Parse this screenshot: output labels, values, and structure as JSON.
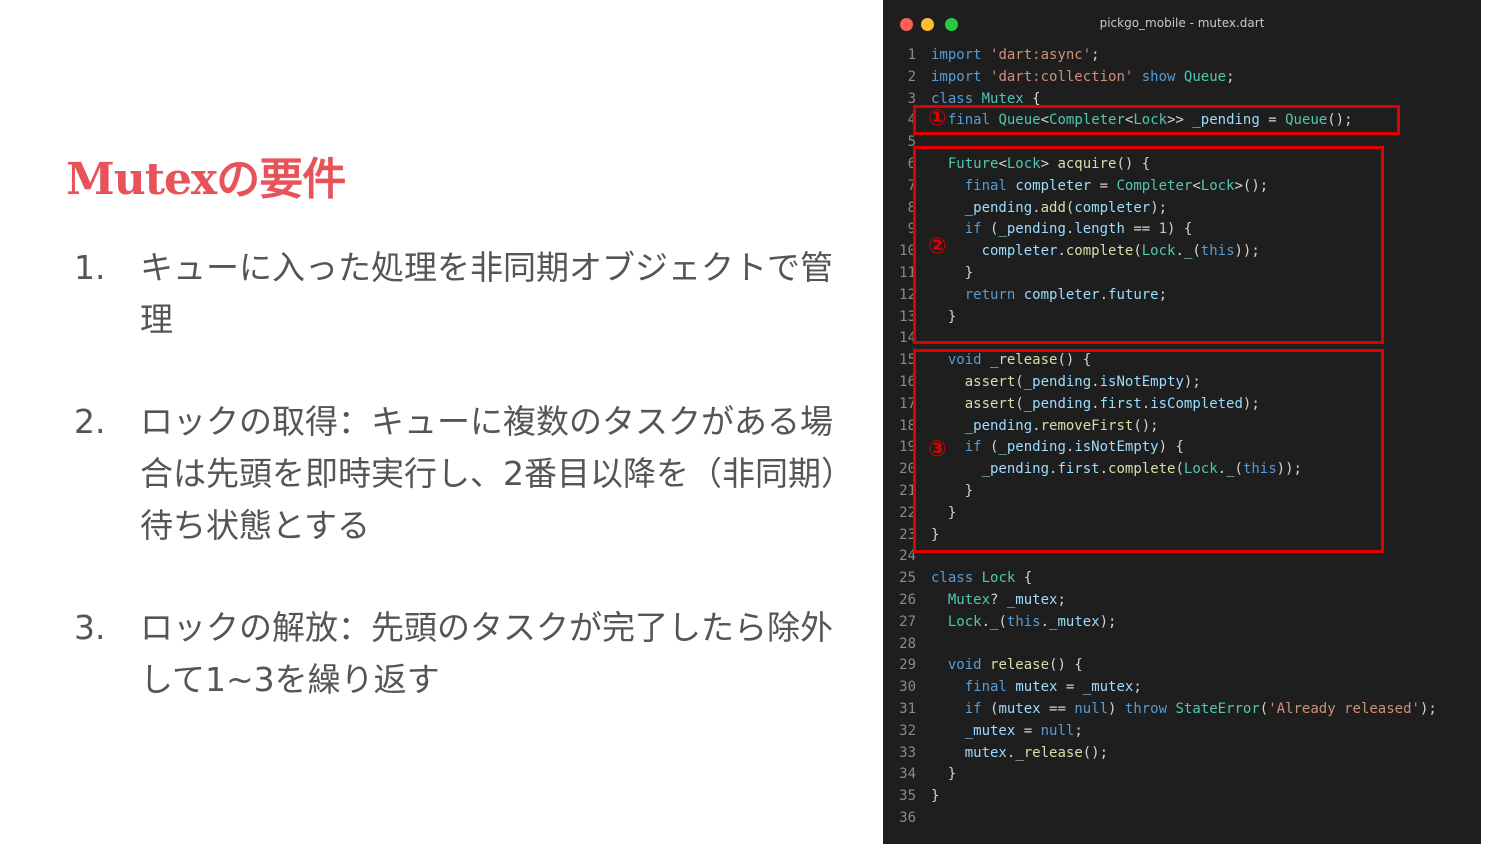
{
  "slide": {
    "title": "Mutexの要件",
    "items": [
      {
        "num": "1.",
        "text": "キューに入った処理を非同期オブジェクトで管理"
      },
      {
        "num": "2.",
        "text": "ロックの取得：キューに複数のタスクがある場合は先頭を即時実行し、2番目以降を（非同期）待ち状態とする"
      },
      {
        "num": "3.",
        "text": "ロックの解放：先頭のタスクが完了したら除外して1~3を繰り返す"
      }
    ]
  },
  "editor": {
    "title": "pickgo_mobile - mutex.dart",
    "badges": [
      "①",
      "②",
      "③"
    ],
    "lines": [
      "import 'dart:async';",
      "import 'dart:collection' show Queue;",
      "class Mutex {",
      "  final Queue<Completer<Lock>> _pending = Queue();",
      "",
      "  Future<Lock> acquire() {",
      "    final completer = Completer<Lock>();",
      "    _pending.add(completer);",
      "    if (_pending.length == 1) {",
      "      completer.complete(Lock._(this));",
      "    }",
      "    return completer.future;",
      "  }",
      "",
      "  void _release() {",
      "    assert(_pending.isNotEmpty);",
      "    assert(_pending.first.isCompleted);",
      "    _pending.removeFirst();",
      "    if (_pending.isNotEmpty) {",
      "      _pending.first.complete(Lock._(this));",
      "    }",
      "  }",
      "}",
      "",
      "class Lock {",
      "  Mutex? _mutex;",
      "  Lock._(this._mutex);",
      "",
      "  void release() {",
      "    final mutex = _mutex;",
      "    if (mutex == null) throw StateError('Already released');",
      "    _mutex = null;",
      "    mutex._release();",
      "  }",
      "}",
      ""
    ]
  }
}
